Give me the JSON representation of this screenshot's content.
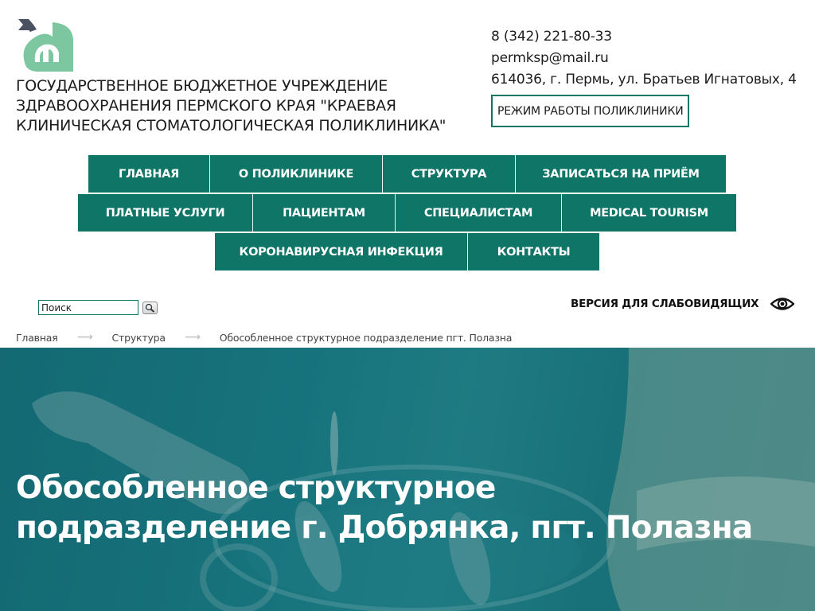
{
  "header": {
    "logo_name": "clinic-logo",
    "org_title": "ГОСУДАРСТВЕННОЕ БЮДЖЕТНОЕ УЧРЕЖДЕНИЕ ЗДРАВООХРАНЕНИЯ ПЕРМСКОГО КРАЯ \"КРАЕВАЯ КЛИНИЧЕСКАЯ СТОМАТОЛОГИЧЕСКАЯ ПОЛИКЛИНИКА\"",
    "org_title_lines": [
      "ГОСУДАРСТВЕННОЕ БЮДЖЕТНОЕ УЧРЕЖДЕНИЕ",
      "ЗДРАВООХРАНЕНИЯ ПЕРМСКОГО КРАЯ \"КРАЕВАЯ",
      "КЛИНИЧЕСКАЯ СТОМАТОЛОГИЧЕСКАЯ ПОЛИКЛИНИКА\""
    ],
    "phone": "8 (342) 221-80-33",
    "email": "permksp@mail.ru",
    "address": "614036, г. Пермь, ул. Братьев Игнатовых, 4",
    "hours_button": "РЕЖИМ РАБОТЫ ПОЛИКЛИНИКИ"
  },
  "nav": {
    "rows": [
      [
        {
          "label": "ГЛАВНАЯ"
        },
        {
          "label": "О ПОЛИКЛИНИКЕ"
        },
        {
          "label": "СТРУКТУРА"
        },
        {
          "label": "ЗАПИСАТЬСЯ НА ПРИЁМ"
        }
      ],
      [
        {
          "label": "ПЛАТНЫЕ УСЛУГИ"
        },
        {
          "label": "ПАЦИЕНТАМ"
        },
        {
          "label": "СПЕЦИАЛИСТАМ"
        },
        {
          "label": "MEDICAL TOURISM"
        }
      ],
      [
        {
          "label": "КОРОНАВИРУСНАЯ ИНФЕКЦИЯ"
        },
        {
          "label": "КОНТАКТЫ"
        }
      ]
    ]
  },
  "search": {
    "value": "Поиск",
    "button_icon": "magnifier-icon"
  },
  "accessibility": {
    "label": "ВЕРСИЯ ДЛЯ СЛАБОВИДЯЩИХ",
    "icon": "eye-icon"
  },
  "breadcrumb": {
    "items": [
      "Главная",
      "Структура",
      "Обособленное структурное подразделение пгт. Полазна"
    ],
    "separator": "⟶"
  },
  "hero": {
    "title_lines": [
      "Обособленное структурное",
      "подразделение г. Добрянка, пгт. Полазна"
    ]
  },
  "colors": {
    "brand_teal": "#0f7566",
    "logo_green": "#7cc7a0",
    "logo_dark": "#4a5160",
    "hero_teal": "#1c7e86"
  }
}
